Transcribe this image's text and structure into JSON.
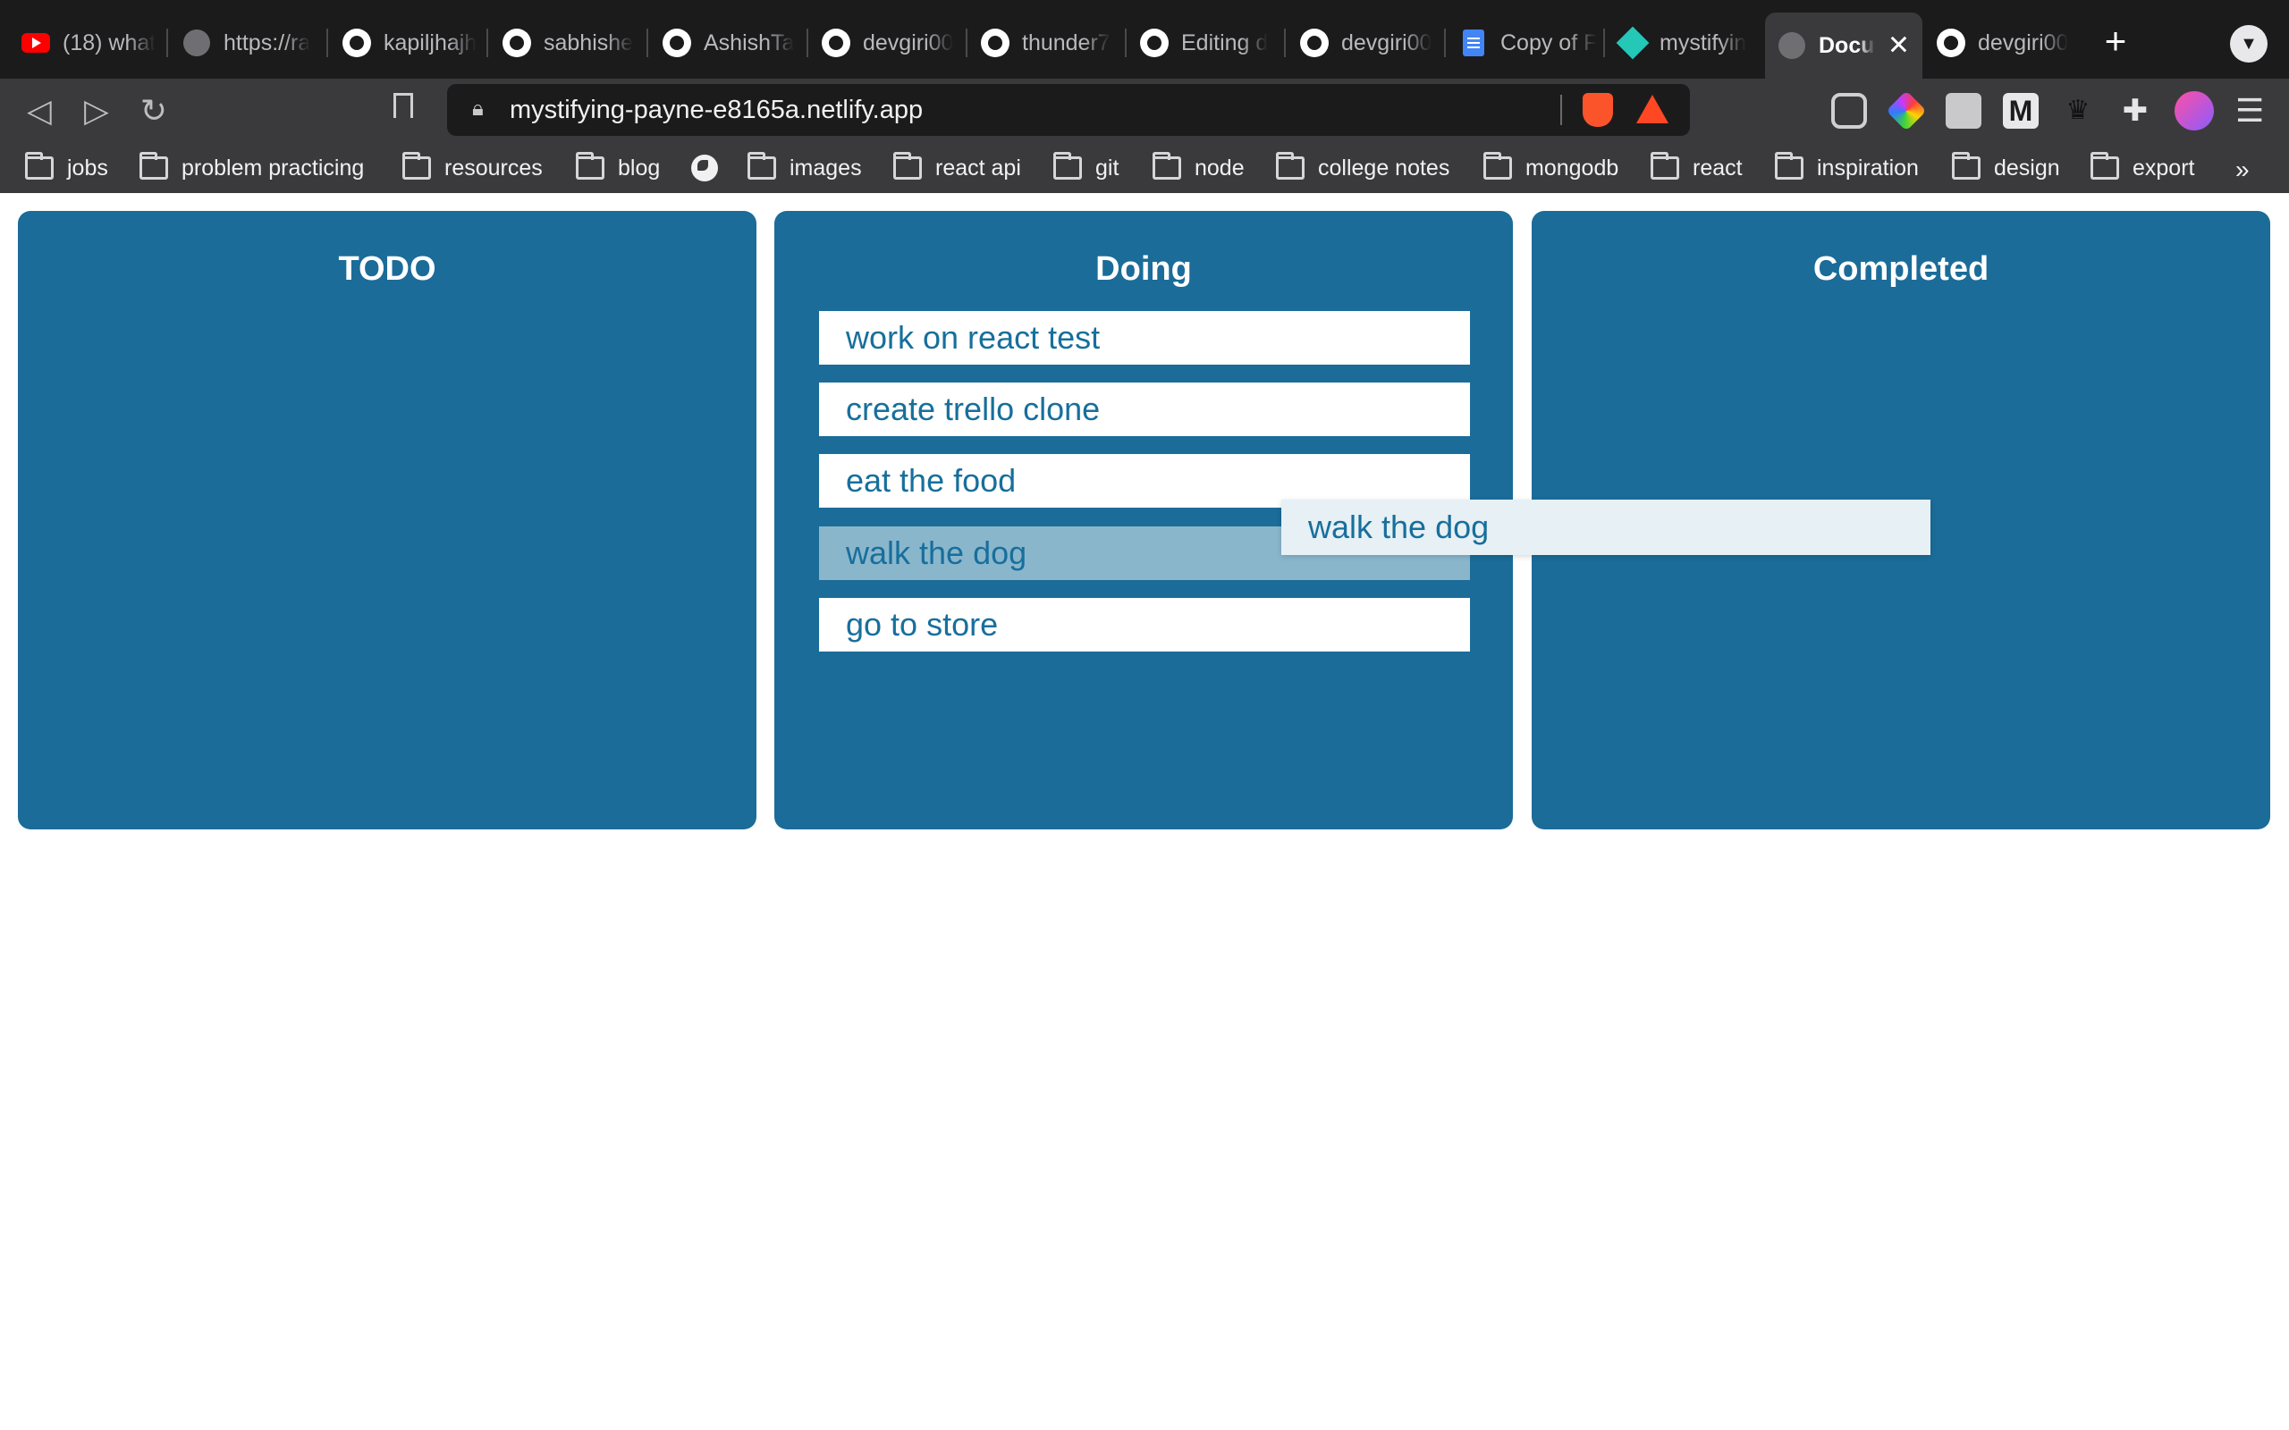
{
  "browser": {
    "tabs": [
      {
        "label": "(18) what",
        "icon": "youtube-icon"
      },
      {
        "label": "https://ra",
        "icon": "globe-icon"
      },
      {
        "label": "kapiljhajh",
        "icon": "github-icon"
      },
      {
        "label": "sabhishe",
        "icon": "github-icon"
      },
      {
        "label": "AshishTa",
        "icon": "github-icon"
      },
      {
        "label": "devgiri00",
        "icon": "github-icon"
      },
      {
        "label": "thunder7",
        "icon": "github-icon"
      },
      {
        "label": "Editing d",
        "icon": "github-icon"
      },
      {
        "label": "devgiri00",
        "icon": "github-icon"
      },
      {
        "label": "Copy of F",
        "icon": "google-docs-icon"
      },
      {
        "label": "mystifyin",
        "icon": "netlify-icon"
      },
      {
        "label": "Docu",
        "icon": "globe-icon",
        "active": true
      },
      {
        "label": "devgiri00",
        "icon": "github-icon"
      }
    ],
    "url": "mystifying-payne-e8165a.netlify.app",
    "bookmarks": [
      {
        "label": "jobs",
        "icon": "folder-icon"
      },
      {
        "label": "problem practicing",
        "icon": "folder-icon"
      },
      {
        "label": "resources",
        "icon": "folder-icon"
      },
      {
        "label": "blog",
        "icon": "folder-icon"
      },
      {
        "label": "",
        "icon": "globe-icon"
      },
      {
        "label": "images",
        "icon": "folder-icon"
      },
      {
        "label": "react api",
        "icon": "folder-icon"
      },
      {
        "label": "git",
        "icon": "folder-icon"
      },
      {
        "label": "node",
        "icon": "folder-icon"
      },
      {
        "label": "college notes",
        "icon": "folder-icon"
      },
      {
        "label": "mongodb",
        "icon": "folder-icon"
      },
      {
        "label": "react",
        "icon": "folder-icon"
      },
      {
        "label": "inspiration",
        "icon": "folder-icon"
      },
      {
        "label": "design",
        "icon": "folder-icon"
      },
      {
        "label": "export",
        "icon": "folder-icon"
      }
    ],
    "more_bookmarks": "»",
    "new_tab_symbol": "+",
    "menu_symbol": "☰"
  },
  "board": {
    "columns": [
      {
        "title": "TODO",
        "cards": []
      },
      {
        "title": "Doing",
        "cards": [
          "work on react test",
          "create trello clone",
          "eat the food",
          "walk the dog",
          "go to store"
        ]
      },
      {
        "title": "Completed",
        "cards": []
      }
    ],
    "dragging": {
      "label": "walk the dog",
      "source_index": 3
    }
  },
  "colors": {
    "column_bg": "#1b6c99",
    "card_text": "#176f9c",
    "placeholder_bg": "#8ab6cc"
  }
}
